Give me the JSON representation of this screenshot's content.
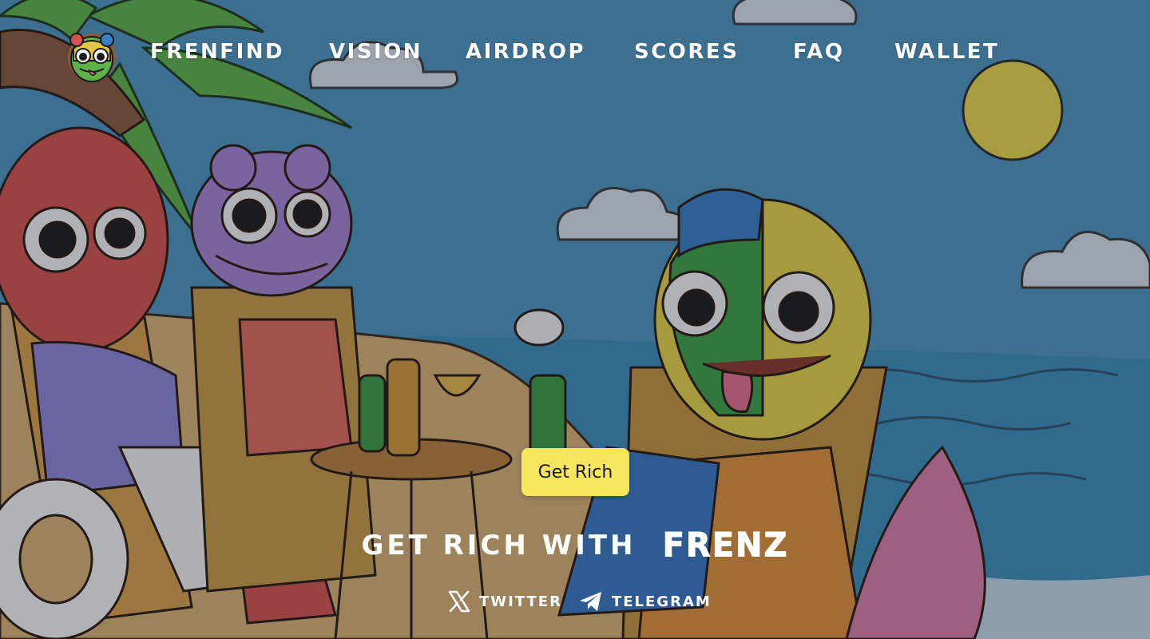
{
  "nav": {
    "items": [
      {
        "label": "FRENFIND"
      },
      {
        "label": "VISION"
      },
      {
        "label": "AIRDROP"
      },
      {
        "label": "SCORES"
      },
      {
        "label": "FAQ"
      },
      {
        "label": "WALLET"
      }
    ]
  },
  "hero": {
    "cta_label": "Get Rich",
    "headline_lead": "GET RICH WITH",
    "headline_brand": "FRENZ"
  },
  "socials": [
    {
      "label": "TWITTER",
      "icon": "x-logo-icon"
    },
    {
      "label": "TELEGRAM",
      "icon": "telegram-icon"
    }
  ],
  "colors": {
    "cta_bg": "#f7e55e",
    "sky": "#4a8fb5",
    "sea": "#3a8cb8",
    "sand": "#d9b574",
    "sun": "#f1dc4e",
    "text": "#ffffff"
  }
}
